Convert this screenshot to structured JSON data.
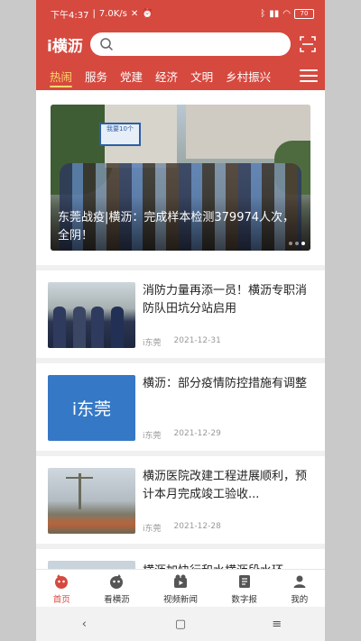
{
  "status_bar": {
    "time": "下午4:37",
    "speed": "7.0K/s",
    "battery": "70"
  },
  "header": {
    "logo": "i横沥",
    "search_placeholder": ""
  },
  "tabs": [
    {
      "label": "热闹",
      "active": true
    },
    {
      "label": "服务",
      "active": false
    },
    {
      "label": "党建",
      "active": false
    },
    {
      "label": "经济",
      "active": false
    },
    {
      "label": "文明",
      "active": false
    },
    {
      "label": "乡村振兴",
      "active": false
    }
  ],
  "banner": {
    "sign_text": "我要10个",
    "caption": "东莞战疫|横沥：完成样本检测379974人次，全阴！"
  },
  "news": [
    {
      "title": "消防力量再添一员！横沥专职消防队田坑分站启用",
      "source": "i东莞",
      "date": "2021-12-31"
    },
    {
      "title": "横沥：部分疫情防控措施有调整",
      "source": "i东莞",
      "date": "2021-12-29",
      "thumb_text": "i东莞"
    },
    {
      "title": "横沥医院改建工程进展顺利，预计本月完成竣工验收...",
      "source": "i东莞",
      "date": "2021-12-28"
    },
    {
      "title": "横沥加快行和水横沥段水环",
      "source": "",
      "date": ""
    }
  ],
  "bottom_nav": [
    {
      "label": "首页",
      "icon": "home-icon",
      "active": true
    },
    {
      "label": "看横沥",
      "icon": "watch-icon",
      "active": false
    },
    {
      "label": "视频新闻",
      "icon": "video-icon",
      "active": false
    },
    {
      "label": "数字报",
      "icon": "newspaper-icon",
      "active": false
    },
    {
      "label": "我的",
      "icon": "profile-icon",
      "active": false
    }
  ],
  "colors": {
    "brand": "#d6493f",
    "tab_active": "#ffd86a"
  }
}
